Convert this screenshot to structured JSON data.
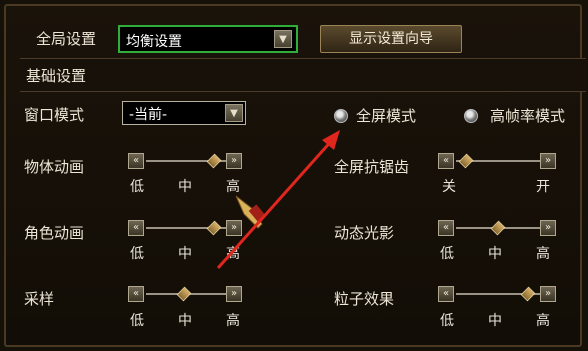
{
  "header": {
    "global_label": "全局设置",
    "global_value": "均衡设置",
    "wizard_button": "显示设置向导"
  },
  "section": {
    "title": "基础设置"
  },
  "window_mode": {
    "label": "窗口模式",
    "value": "-当前-",
    "radio_fullscreen": "全屏模式",
    "radio_highfps": "高帧率模式"
  },
  "sliders": [
    {
      "label": "物体动画",
      "ticks": [
        "低",
        "中",
        "高"
      ],
      "level": "high"
    },
    {
      "label": "角色动画",
      "ticks": [
        "低",
        "中",
        "高"
      ],
      "level": "high"
    },
    {
      "label": "采样",
      "ticks": [
        "低",
        "中",
        "高"
      ],
      "level": "middle"
    },
    {
      "label": "全屏抗锯齿",
      "ticks": [
        "关",
        "开"
      ],
      "level": "off"
    },
    {
      "label": "动态光影",
      "ticks": [
        "低",
        "中",
        "高"
      ],
      "level": "middle"
    },
    {
      "label": "粒子效果",
      "ticks": [
        "低",
        "中",
        "高"
      ],
      "level": "high"
    }
  ],
  "colors": {
    "green_border": "#2fae3a",
    "annotation_arrow": "#e0261d"
  }
}
